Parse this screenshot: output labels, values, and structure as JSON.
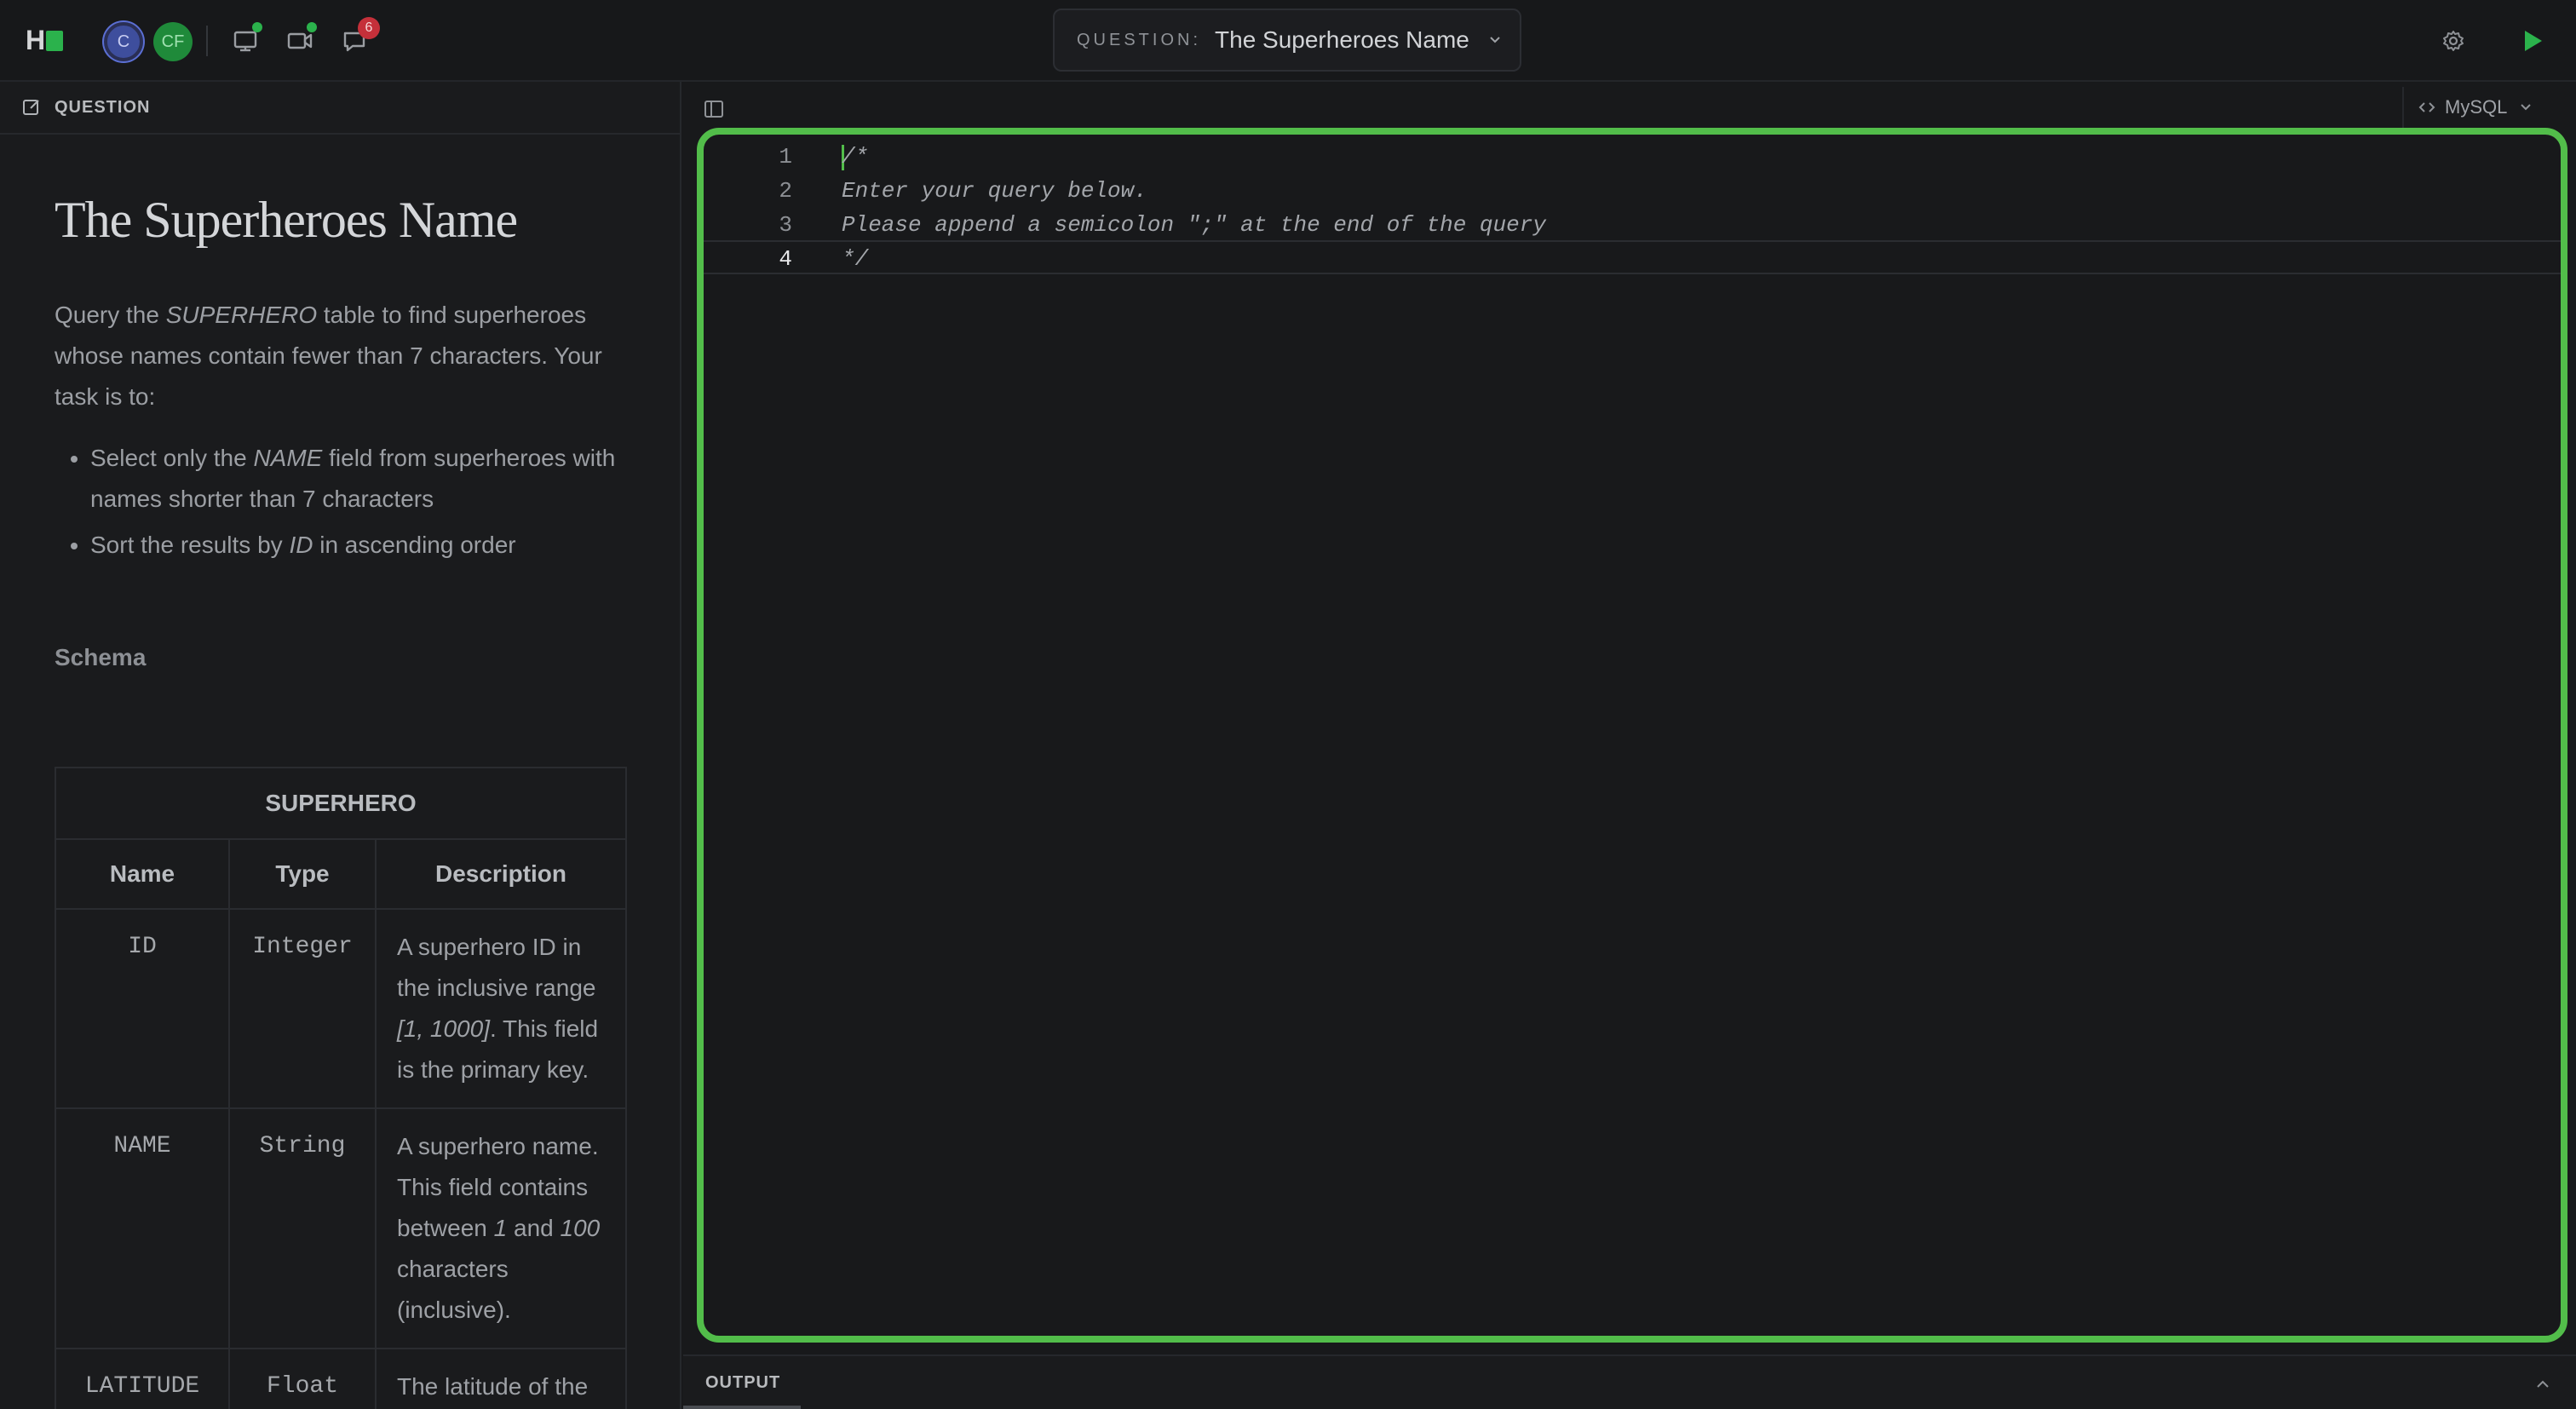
{
  "app": {
    "logo_letter": "H",
    "brand_color": "#2bb24c"
  },
  "topbar": {
    "avatars": [
      {
        "initials": "C",
        "color": "#3e4e9d"
      },
      {
        "initials": "CF",
        "color": "#1f8a3a"
      }
    ],
    "icons": [
      "screen-share-icon",
      "video-icon",
      "chat-icon"
    ],
    "chat_badge": "6",
    "question_label": "QUESTION:",
    "question_value": "The Superheroes Name",
    "settings_icon": "gear-icon",
    "run_icon": "play-icon"
  },
  "left_panel": {
    "header_label": "QUESTION",
    "title": "The Superheroes Name",
    "description": {
      "prefix": "Query the ",
      "table_name": "SUPERHERO",
      "suffix": " table to find superheroes whose names contain fewer than 7 characters. Your task is to:"
    },
    "tasks": [
      {
        "prefix": "Select only the ",
        "emph": "NAME",
        "suffix": " field from superheroes with names shorter than 7 characters"
      },
      {
        "prefix": "Sort the results by ",
        "emph": "ID",
        "suffix": " in ascending order"
      }
    ],
    "schema_heading": "Schema",
    "schema_table": {
      "name": "SUPERHERO",
      "headers": [
        "Name",
        "Type",
        "Description"
      ],
      "rows": [
        {
          "name": "ID",
          "type": "Integer",
          "desc_a": "A superhero ID in the inclusive range ",
          "desc_emph": "[1, 1000]",
          "desc_b": ". This field is the primary key."
        },
        {
          "name": "NAME",
          "type": "String",
          "desc_a": "A superhero name. This field contains between ",
          "desc_emph1": "1",
          "desc_mid": " and ",
          "desc_emph2": "100",
          "desc_b": " characters (inclusive)."
        },
        {
          "name": "LATITUDE",
          "type": "Float",
          "desc_a": "The latitude of the"
        }
      ]
    }
  },
  "editor": {
    "language": "MySQL",
    "lines": [
      {
        "num": "1",
        "text": "/*"
      },
      {
        "num": "2",
        "text": "Enter your query below."
      },
      {
        "num": "3",
        "text": "Please append a semicolon \";\" at the end of the query"
      },
      {
        "num": "4",
        "text": "*/"
      }
    ],
    "focus_color": "#52bd4a"
  },
  "output": {
    "tab_label": "OUTPUT"
  }
}
